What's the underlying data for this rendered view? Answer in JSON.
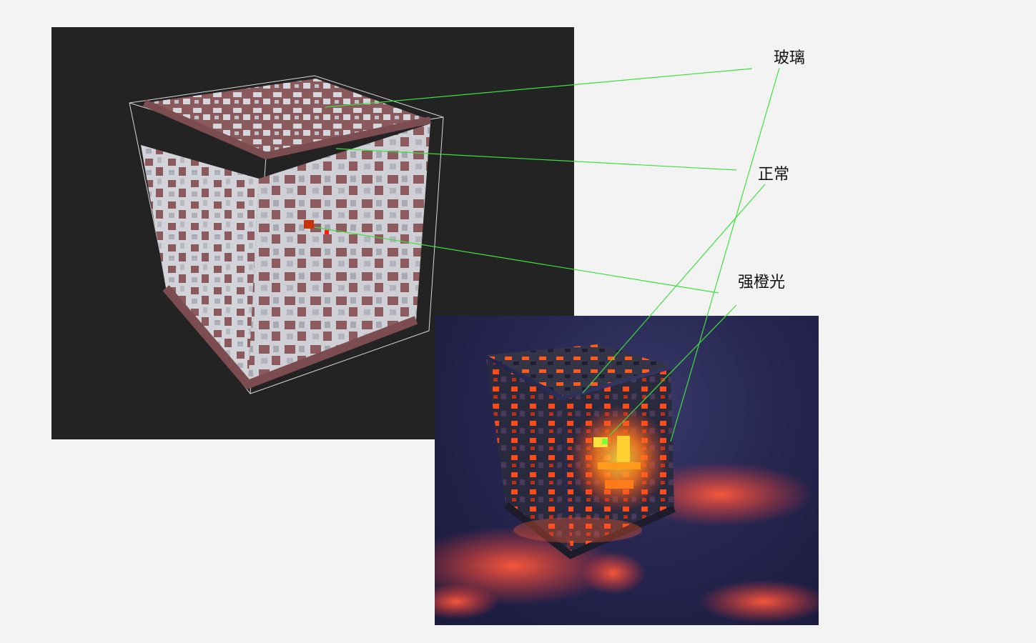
{
  "labels": {
    "glass": "玻璃",
    "normal": "正常",
    "orange_light": "强橙光"
  },
  "colors": {
    "page_background": "#f3f3f3",
    "editor_background": "#232323",
    "render_background": "#262650",
    "voxel_brick": "#8a5a5c",
    "voxel_glass": "#d6d6dc",
    "emissive_orange": "#ff5a1e",
    "emissive_yellow": "#ffe040",
    "leader_line": "#3ee03e"
  }
}
